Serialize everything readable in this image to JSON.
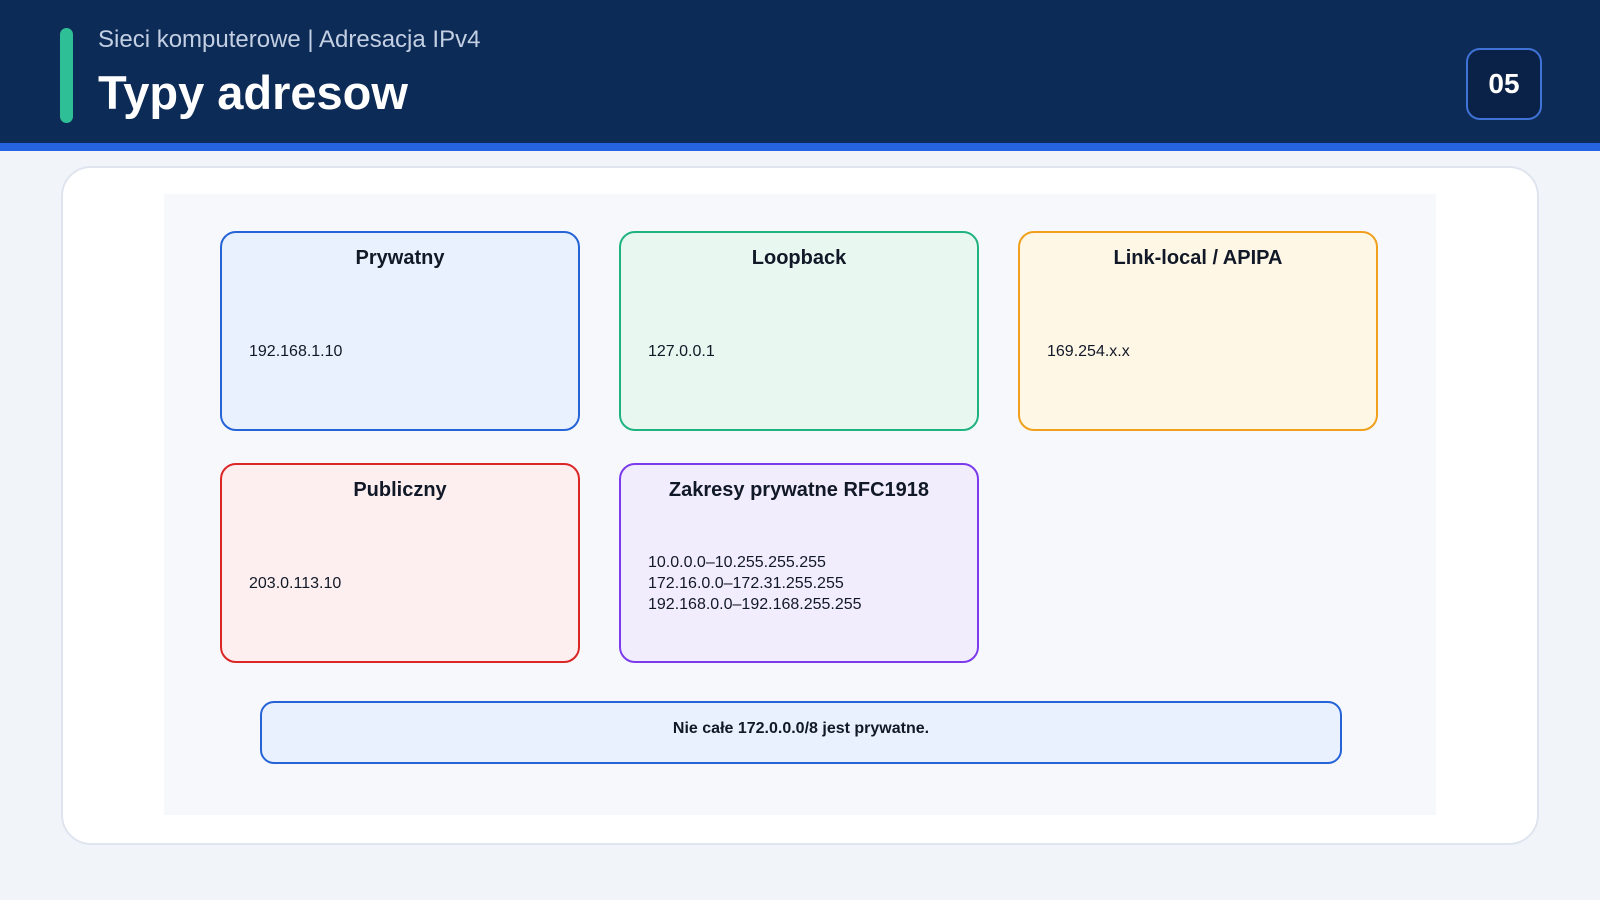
{
  "header": {
    "subtitle": "Sieci komputerowe | Adresacja IPv4",
    "title": "Typy adresow",
    "page_number": "05"
  },
  "colors": {
    "header_bg": "#0d2b57",
    "header_accent_line": "#2563e0",
    "accent_bar": "#2fbf97"
  },
  "diagram": {
    "nodes": [
      {
        "id": "private",
        "title": "Prywatny",
        "lines": [
          "192.168.1.10"
        ],
        "border": "#2563d6",
        "fill": "#eaf1fe"
      },
      {
        "id": "loopback",
        "title": "Loopback",
        "lines": [
          "127.0.0.1"
        ],
        "border": "#1fb380",
        "fill": "#e8f7f0"
      },
      {
        "id": "linklocal",
        "title": "Link-local / APIPA",
        "lines": [
          "169.254.x.x"
        ],
        "border": "#f0a01c",
        "fill": "#fef7e6"
      },
      {
        "id": "public",
        "title": "Publiczny",
        "lines": [
          "203.0.113.10"
        ],
        "border": "#dc2626",
        "fill": "#fdefef"
      },
      {
        "id": "rfc1918",
        "title": "Zakresy prywatne RFC1918",
        "lines": [
          "10.0.0.0–10.255.255.255",
          "172.16.0.0–172.31.255.255",
          "192.168.0.0–192.168.255.255"
        ],
        "border": "#7c3aed",
        "fill": "#f2edfd"
      }
    ],
    "note": {
      "text": "Nie całe 172.0.0.0/8 jest prywatne.",
      "border": "#2563d6",
      "fill": "#eaf1fe"
    }
  }
}
